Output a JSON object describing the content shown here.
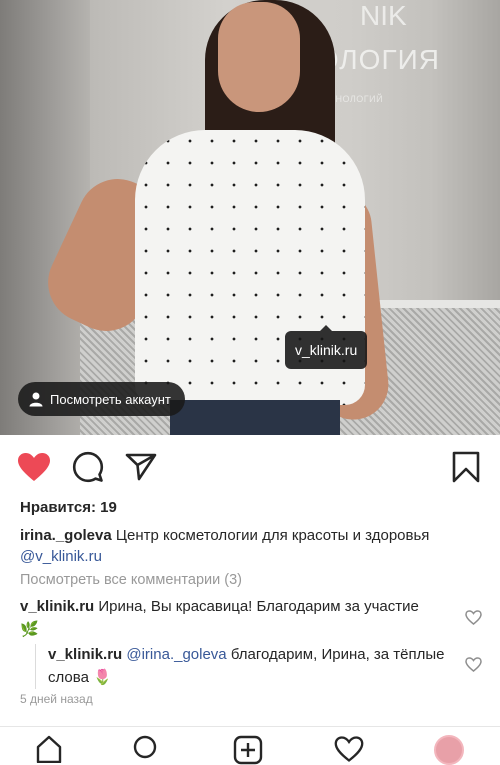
{
  "photo": {
    "sign_text": "ТОЛОГИЯ",
    "sign_top": "NIK",
    "sign_sub": "ИХ ТЕХНОЛОГИЙ",
    "tag_label": "v_klinik.ru",
    "view_account_label": "Посмотреть аккаунт"
  },
  "actions": {
    "like_icon": "heart-filled-icon",
    "comment_icon": "comment-icon",
    "share_icon": "paper-plane-icon",
    "save_icon": "bookmark-icon",
    "like_color": "#ed4956"
  },
  "likes_text": "Нравится: 19",
  "caption": {
    "username": "irina._goleva",
    "text": " Центр косметологии для красоты и здоровья ",
    "mention": "@v_klinik.ru"
  },
  "view_all_comments": "Посмотреть все комментарии (3)",
  "comments": [
    {
      "username": "v_klinik.ru",
      "text": " Ирина, Вы красавица! Благодарим за участие ",
      "emoji": "🌿"
    },
    {
      "username": "v_klinik.ru",
      "mention": " @irina._goleva",
      "text": " благодарим, Ирина, за тёплые слова ",
      "emoji": "🌷"
    }
  ],
  "timestamp": "5 дней назад",
  "bottom_nav": [
    "home-icon",
    "search-icon",
    "add-post-icon",
    "activity-heart-icon",
    "profile-avatar"
  ]
}
